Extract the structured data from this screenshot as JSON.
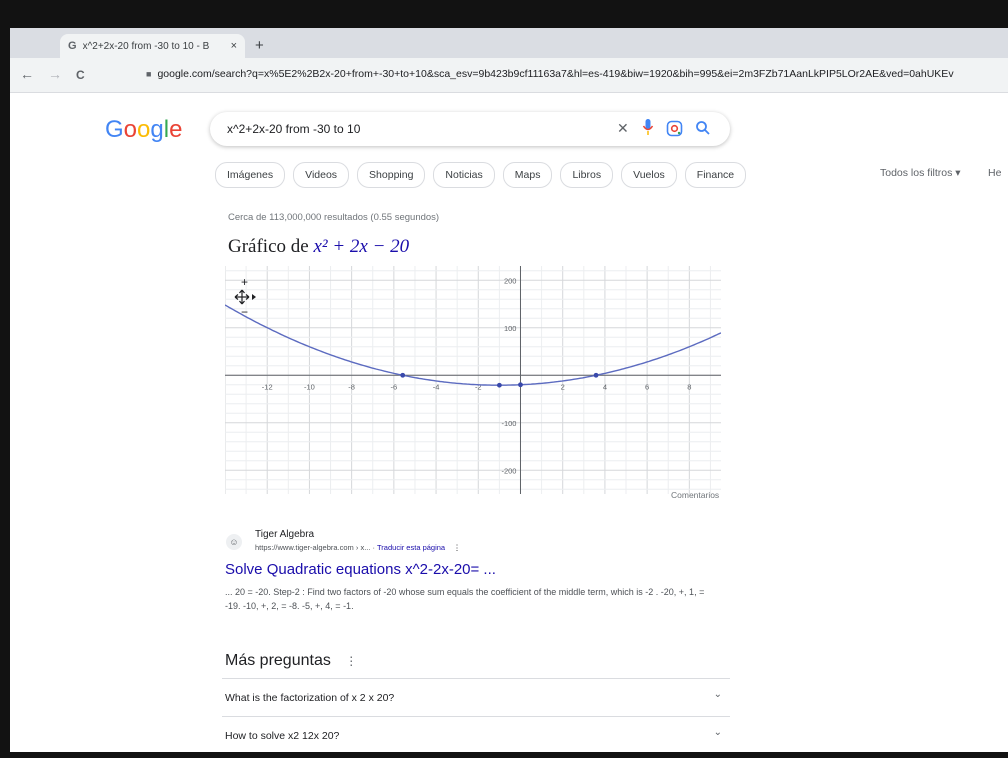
{
  "browser": {
    "tab_icon": "G",
    "tab_title": "x^2+2x-20 from -30 to 10 - B",
    "tab_close": "×",
    "new_tab": "+",
    "back": "←",
    "forward": "→",
    "reload": "C",
    "url_host": "google.com",
    "url_path": "/search?q=x%5E2%2B2x-20+from+-30+to+10&sca_esv=9b423b9cf11163a7&hl=es-419&biw=1920&bih=995&ei=2m3FZb71AanLkPIP5LOr2AE&ved=0ahUKEv"
  },
  "google": {
    "logo_letters": [
      "G",
      "o",
      "o",
      "g",
      "l",
      "e"
    ],
    "logo_colors": [
      "#4285F4",
      "#EA4335",
      "#FBBC05",
      "#4285F4",
      "#34A853",
      "#EA4335"
    ],
    "query": "x^2+2x-20 from -30 to 10",
    "clear_icon": "✕",
    "filters": [
      "Imágenes",
      "Videos",
      "Shopping",
      "Noticias",
      "Maps",
      "Libros",
      "Vuelos",
      "Finance"
    ],
    "all_filters": "Todos los filtros",
    "tools": "He",
    "stats": "Cerca de 113,000,000 resultados (0.55 segundos)",
    "graph_title_prefix": "Gráfico de",
    "graph_title_expr": "x² + 2x − 20",
    "comentarios": "Comentarios",
    "zoom_in": "+",
    "zoom_out": "−"
  },
  "chart_data": {
    "type": "line",
    "function": "x^2+2x-20",
    "xlim": [
      -14,
      9.5
    ],
    "ylim": [
      -250,
      230
    ],
    "x_ticks": [
      -12,
      -10,
      -8,
      -6,
      -4,
      -2,
      2,
      4,
      6,
      8
    ],
    "y_ticks": [
      200,
      100,
      -100,
      -200
    ],
    "grid": true,
    "key_points": [
      {
        "x": -5.58,
        "y": 0
      },
      {
        "x": -1,
        "y": -21
      },
      {
        "x": 0,
        "y": -20
      },
      {
        "x": 3.58,
        "y": 0
      }
    ],
    "line_color": "#5c6bc0"
  },
  "result": {
    "favicon": "☺",
    "site_name": "Tiger Algebra",
    "url": "https://www.tiger-algebra.com › x... ·",
    "translate": "Traducir esta página",
    "menu": "⋮",
    "title": "Solve Quadratic equations x^2-2x-20= ...",
    "snippet": "... 20 = -20. Step-2 : Find two factors of -20 whose sum equals the coefficient of the middle term, which is -2 . -20, +, 1, = -19. -10, +, 2, = -8. -5, +, 4, = -1."
  },
  "questions": {
    "heading": "Más preguntas",
    "menu": "⋮",
    "items": [
      "What is the factorization of x 2 x 20?",
      "How to solve x2 12x 20?"
    ]
  }
}
